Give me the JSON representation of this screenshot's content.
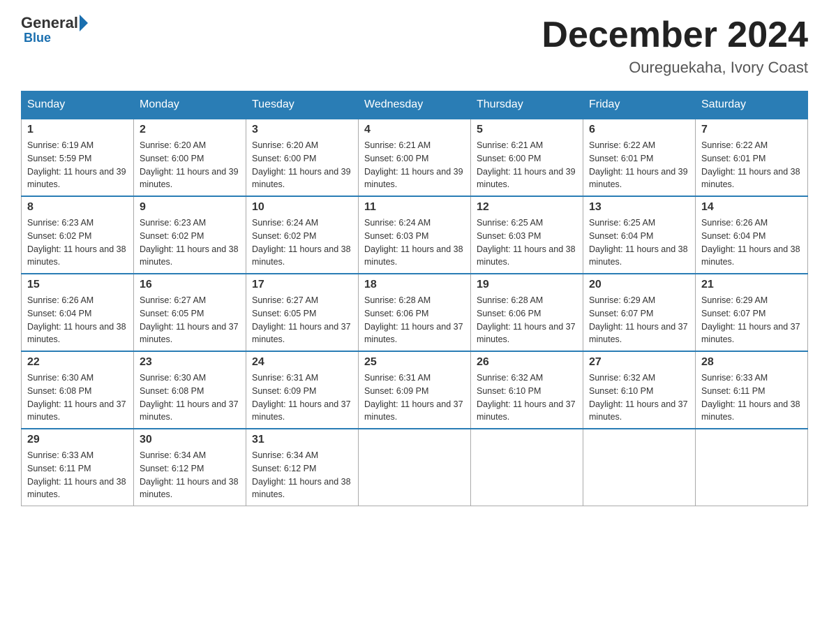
{
  "header": {
    "logo_general": "General",
    "logo_blue": "Blue",
    "main_title": "December 2024",
    "subtitle": "Oureguekaha, Ivory Coast"
  },
  "days_of_week": [
    "Sunday",
    "Monday",
    "Tuesday",
    "Wednesday",
    "Thursday",
    "Friday",
    "Saturday"
  ],
  "weeks": [
    [
      {
        "day": "1",
        "sunrise": "6:19 AM",
        "sunset": "5:59 PM",
        "daylight": "11 hours and 39 minutes."
      },
      {
        "day": "2",
        "sunrise": "6:20 AM",
        "sunset": "6:00 PM",
        "daylight": "11 hours and 39 minutes."
      },
      {
        "day": "3",
        "sunrise": "6:20 AM",
        "sunset": "6:00 PM",
        "daylight": "11 hours and 39 minutes."
      },
      {
        "day": "4",
        "sunrise": "6:21 AM",
        "sunset": "6:00 PM",
        "daylight": "11 hours and 39 minutes."
      },
      {
        "day": "5",
        "sunrise": "6:21 AM",
        "sunset": "6:00 PM",
        "daylight": "11 hours and 39 minutes."
      },
      {
        "day": "6",
        "sunrise": "6:22 AM",
        "sunset": "6:01 PM",
        "daylight": "11 hours and 39 minutes."
      },
      {
        "day": "7",
        "sunrise": "6:22 AM",
        "sunset": "6:01 PM",
        "daylight": "11 hours and 38 minutes."
      }
    ],
    [
      {
        "day": "8",
        "sunrise": "6:23 AM",
        "sunset": "6:02 PM",
        "daylight": "11 hours and 38 minutes."
      },
      {
        "day": "9",
        "sunrise": "6:23 AM",
        "sunset": "6:02 PM",
        "daylight": "11 hours and 38 minutes."
      },
      {
        "day": "10",
        "sunrise": "6:24 AM",
        "sunset": "6:02 PM",
        "daylight": "11 hours and 38 minutes."
      },
      {
        "day": "11",
        "sunrise": "6:24 AM",
        "sunset": "6:03 PM",
        "daylight": "11 hours and 38 minutes."
      },
      {
        "day": "12",
        "sunrise": "6:25 AM",
        "sunset": "6:03 PM",
        "daylight": "11 hours and 38 minutes."
      },
      {
        "day": "13",
        "sunrise": "6:25 AM",
        "sunset": "6:04 PM",
        "daylight": "11 hours and 38 minutes."
      },
      {
        "day": "14",
        "sunrise": "6:26 AM",
        "sunset": "6:04 PM",
        "daylight": "11 hours and 38 minutes."
      }
    ],
    [
      {
        "day": "15",
        "sunrise": "6:26 AM",
        "sunset": "6:04 PM",
        "daylight": "11 hours and 38 minutes."
      },
      {
        "day": "16",
        "sunrise": "6:27 AM",
        "sunset": "6:05 PM",
        "daylight": "11 hours and 37 minutes."
      },
      {
        "day": "17",
        "sunrise": "6:27 AM",
        "sunset": "6:05 PM",
        "daylight": "11 hours and 37 minutes."
      },
      {
        "day": "18",
        "sunrise": "6:28 AM",
        "sunset": "6:06 PM",
        "daylight": "11 hours and 37 minutes."
      },
      {
        "day": "19",
        "sunrise": "6:28 AM",
        "sunset": "6:06 PM",
        "daylight": "11 hours and 37 minutes."
      },
      {
        "day": "20",
        "sunrise": "6:29 AM",
        "sunset": "6:07 PM",
        "daylight": "11 hours and 37 minutes."
      },
      {
        "day": "21",
        "sunrise": "6:29 AM",
        "sunset": "6:07 PM",
        "daylight": "11 hours and 37 minutes."
      }
    ],
    [
      {
        "day": "22",
        "sunrise": "6:30 AM",
        "sunset": "6:08 PM",
        "daylight": "11 hours and 37 minutes."
      },
      {
        "day": "23",
        "sunrise": "6:30 AM",
        "sunset": "6:08 PM",
        "daylight": "11 hours and 37 minutes."
      },
      {
        "day": "24",
        "sunrise": "6:31 AM",
        "sunset": "6:09 PM",
        "daylight": "11 hours and 37 minutes."
      },
      {
        "day": "25",
        "sunrise": "6:31 AM",
        "sunset": "6:09 PM",
        "daylight": "11 hours and 37 minutes."
      },
      {
        "day": "26",
        "sunrise": "6:32 AM",
        "sunset": "6:10 PM",
        "daylight": "11 hours and 37 minutes."
      },
      {
        "day": "27",
        "sunrise": "6:32 AM",
        "sunset": "6:10 PM",
        "daylight": "11 hours and 37 minutes."
      },
      {
        "day": "28",
        "sunrise": "6:33 AM",
        "sunset": "6:11 PM",
        "daylight": "11 hours and 38 minutes."
      }
    ],
    [
      {
        "day": "29",
        "sunrise": "6:33 AM",
        "sunset": "6:11 PM",
        "daylight": "11 hours and 38 minutes."
      },
      {
        "day": "30",
        "sunrise": "6:34 AM",
        "sunset": "6:12 PM",
        "daylight": "11 hours and 38 minutes."
      },
      {
        "day": "31",
        "sunrise": "6:34 AM",
        "sunset": "6:12 PM",
        "daylight": "11 hours and 38 minutes."
      },
      null,
      null,
      null,
      null
    ]
  ]
}
